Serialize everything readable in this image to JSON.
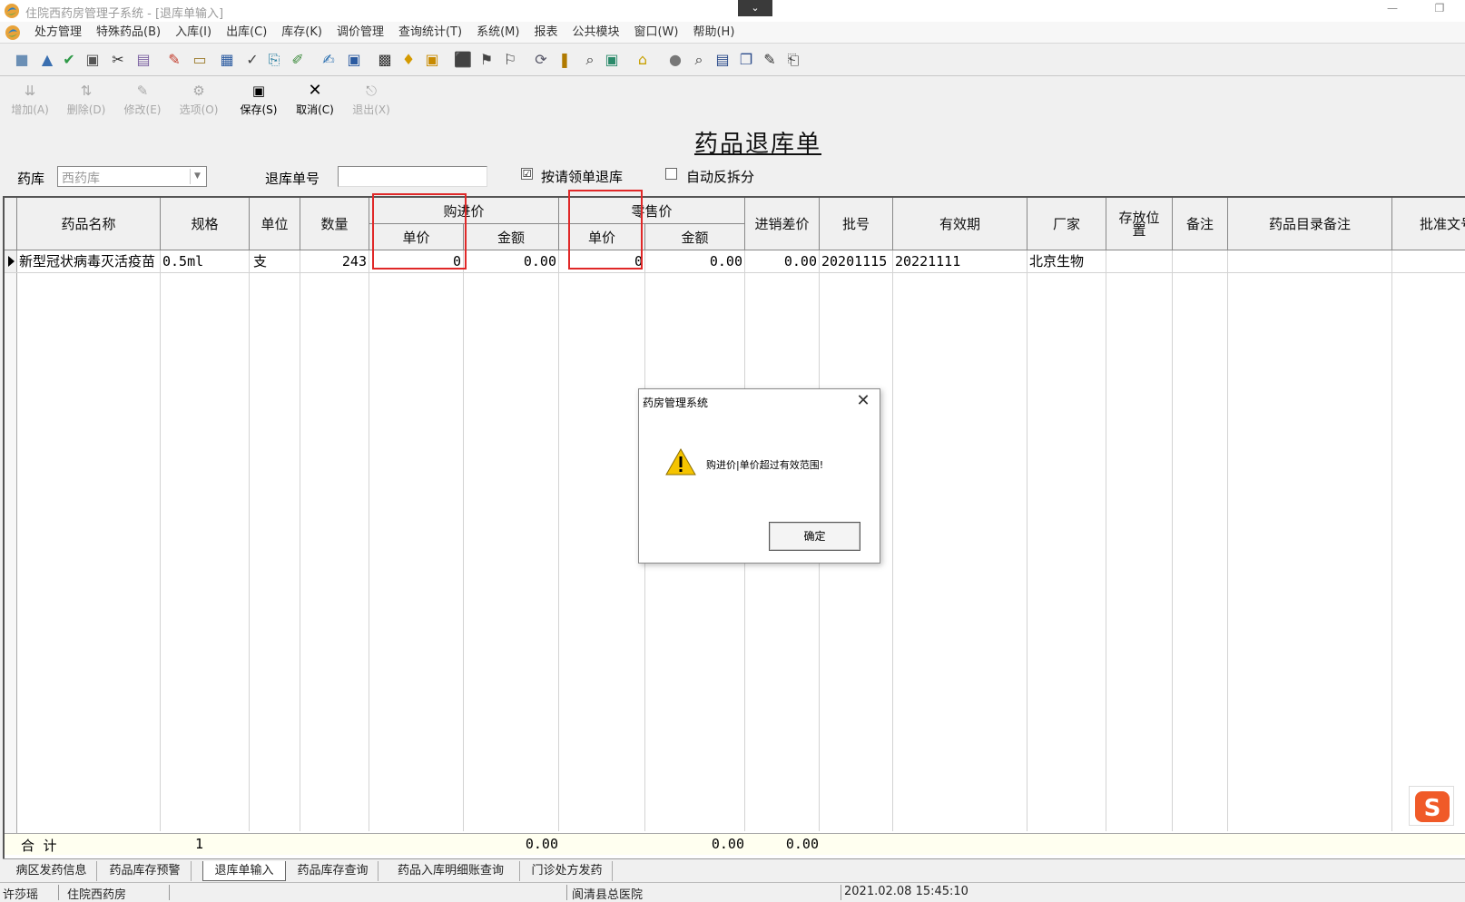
{
  "window": {
    "title": "住院西药房管理子系统 - [退库单输入]",
    "collapse_tab": "⌄",
    "min": "—",
    "restore": "❐"
  },
  "menu": [
    "处方管理",
    "特殊药品(B)",
    "入库(I)",
    "出库(C)",
    "库存(K)",
    "调价管理",
    "查询统计(T)",
    "系统(M)",
    "报表",
    "公共模块",
    "窗口(W)",
    "帮助(H)"
  ],
  "actions": [
    {
      "label": "增加(A)",
      "enabled": false,
      "icon": "add-row-icon"
    },
    {
      "label": "删除(D)",
      "enabled": false,
      "icon": "delete-row-icon"
    },
    {
      "label": "修改(E)",
      "enabled": false,
      "icon": "edit-icon"
    },
    {
      "label": "选项(O)",
      "enabled": false,
      "icon": "options-icon"
    },
    {
      "label": "保存(S)",
      "enabled": true,
      "icon": "save-icon"
    },
    {
      "label": "取消(C)",
      "enabled": true,
      "icon": "cancel-icon"
    },
    {
      "label": "退出(X)",
      "enabled": false,
      "icon": "exit-icon"
    }
  ],
  "nav": [
    "⏮",
    "◀",
    "▶",
    "⏭"
  ],
  "form": {
    "title": "药品退库单",
    "pharmacy_label": "药库",
    "pharmacy_value": "西药库",
    "return_no_label": "退库单号",
    "return_no_value": "",
    "by_request_label": "按请领单退库",
    "by_request_checked": "☑",
    "auto_split_label": "自动反拆分"
  },
  "table": {
    "headers": {
      "name": "药品名称",
      "spec": "规格",
      "unit": "单位",
      "qty": "数量",
      "purchase": "购进价",
      "purchase_unit": "单价",
      "purchase_amount": "金额",
      "retail": "零售价",
      "retail_unit": "单价",
      "retail_amount": "金额",
      "diff": "进销差价",
      "batch": "批号",
      "expiry": "有效期",
      "maker": "厂家",
      "location": "存放位置",
      "remark": "备注",
      "catalog_remark": "药品目录备注",
      "approval": "批准文号"
    },
    "rows": [
      {
        "name": "新型冠状病毒灭活疫苗",
        "spec": "0.5ml",
        "unit": "支",
        "qty": "243",
        "purchase_unit": "0",
        "purchase_amount": "0.00",
        "retail_unit": "0",
        "retail_amount": "0.00",
        "diff": "0.00",
        "batch": "20201115",
        "expiry": "20221111",
        "maker": "北京生物"
      }
    ],
    "total": {
      "label": "合  计",
      "count": "1",
      "purchase_amount": "0.00",
      "retail_amount": "0.00",
      "diff": "0.00"
    }
  },
  "dialog": {
    "title": "药房管理系统",
    "message": "购进价|单价超过有效范围!",
    "ok": "确定",
    "close": "✕"
  },
  "tabs": [
    "病区发药信息",
    "药品库存预警",
    "退库单输入",
    "药品库存查询",
    "药品入库明细账查询",
    "门诊处方发药"
  ],
  "active_tab": "退库单输入",
  "status": {
    "user": "许莎瑶",
    "dept": "住院西药房",
    "hospital": "阆清县总医院",
    "datetime": "2021.02.08 15:45:10"
  },
  "colors": {
    "highlight": "#e02828",
    "total_row_bg": "#fffff0"
  }
}
